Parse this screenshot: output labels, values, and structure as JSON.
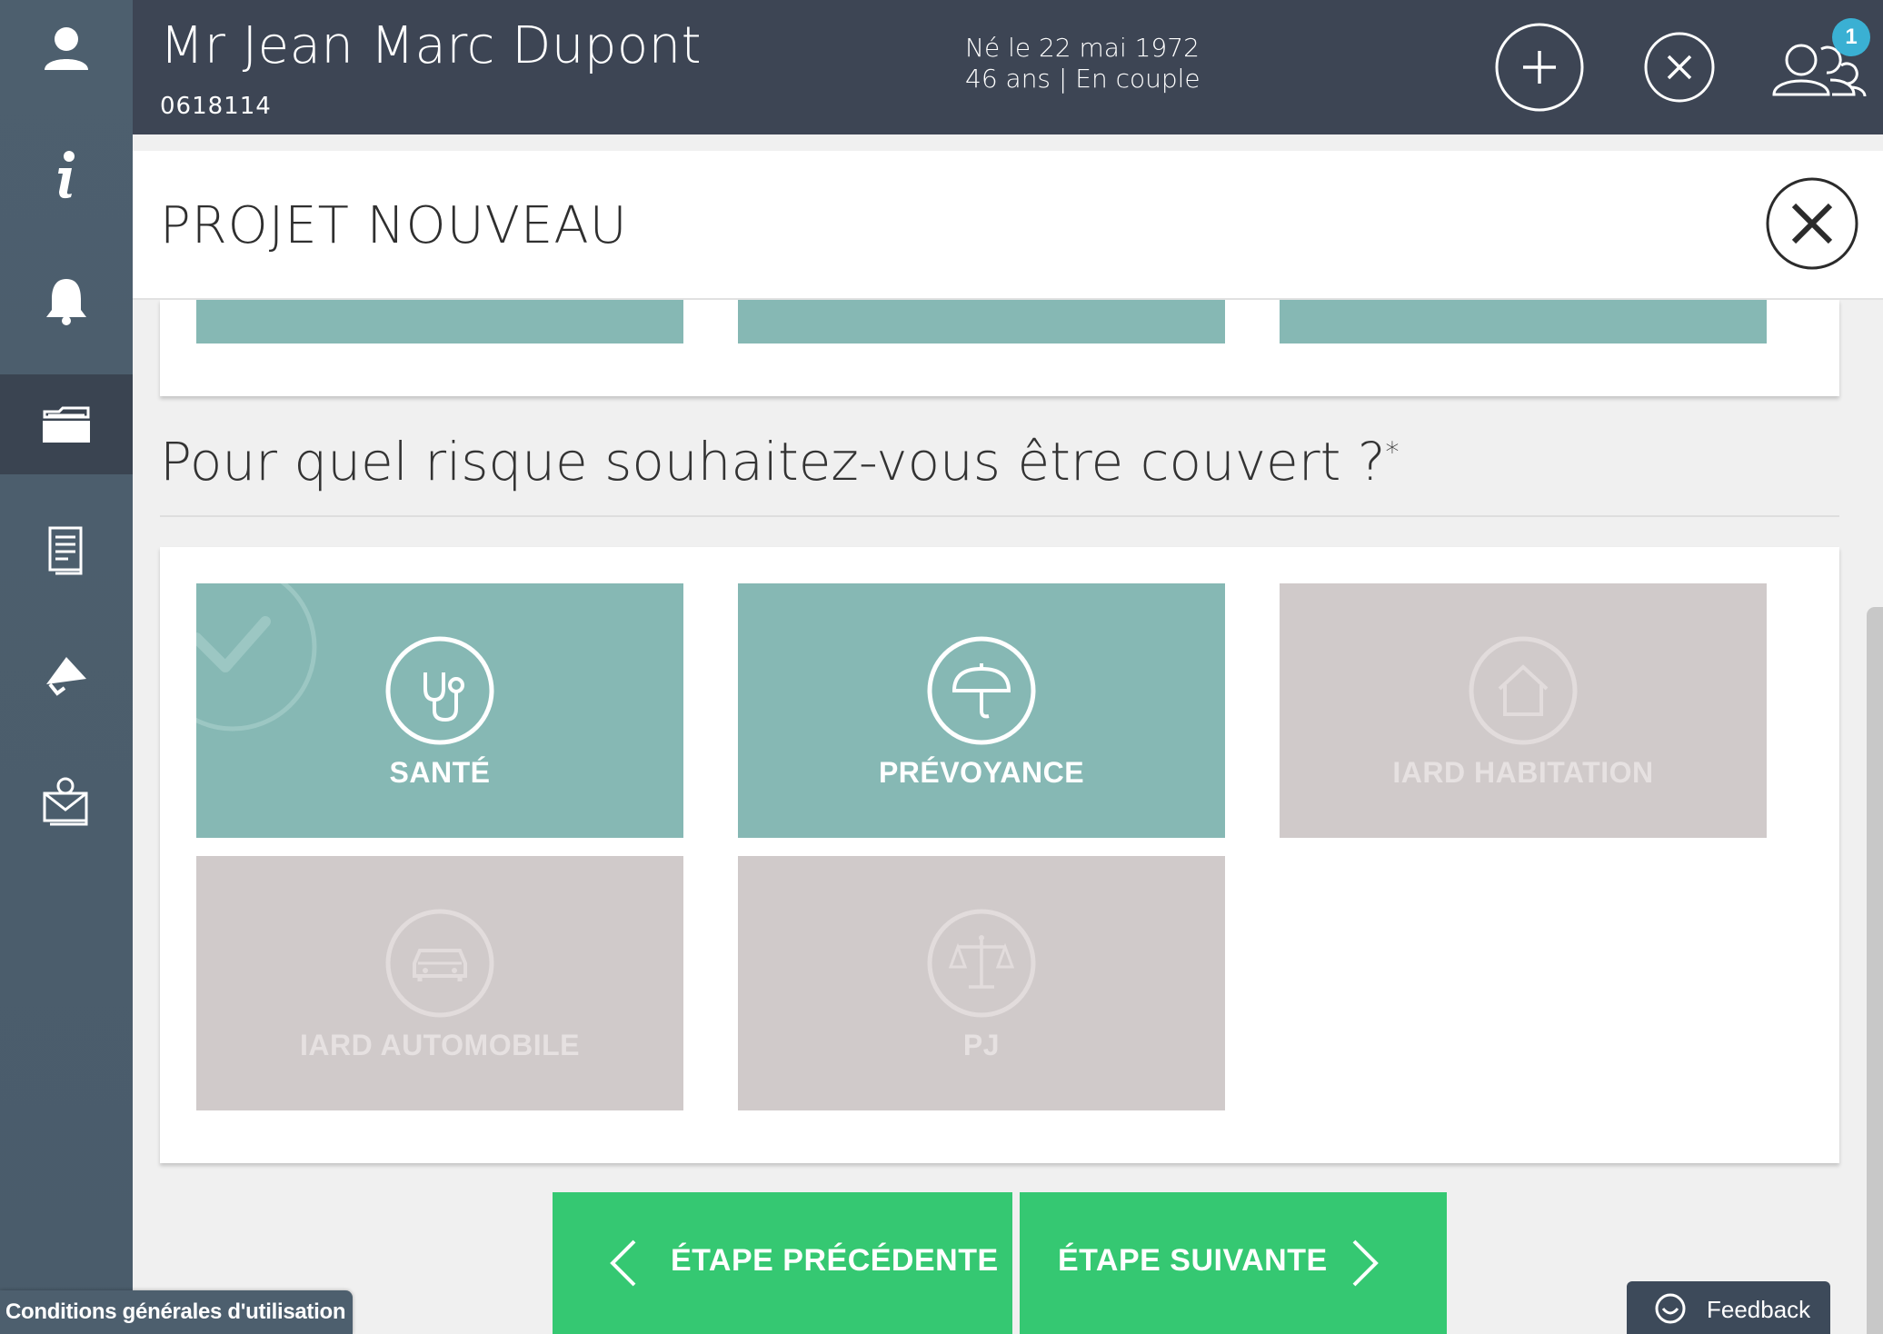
{
  "client": {
    "name": "Mr Jean Marc Dupont",
    "id": "0618114",
    "birth": "Né le 22 mai 1972",
    "age_status": "46 ans | En couple",
    "notification_count": "1"
  },
  "sidebar": {
    "items": [
      {
        "icon": "user-icon"
      },
      {
        "icon": "info-icon"
      },
      {
        "icon": "bell-icon"
      },
      {
        "icon": "folders-icon",
        "active": true
      },
      {
        "icon": "document-icon"
      },
      {
        "icon": "megaphone-icon"
      },
      {
        "icon": "mail-icon"
      }
    ]
  },
  "project": {
    "title": "PROJET NOUVEAU"
  },
  "question": {
    "text": "Pour quel risque souhaitez-vous être couvert ?",
    "required_mark": "*"
  },
  "options": [
    {
      "label": "SANTÉ",
      "icon": "stethoscope-icon",
      "state": "selected"
    },
    {
      "label": "PRÉVOYANCE",
      "icon": "umbrella-icon",
      "state": "selected"
    },
    {
      "label": "IARD HABITATION",
      "icon": "house-icon",
      "state": "disabled"
    },
    {
      "label": "IARD AUTOMOBILE",
      "icon": "car-icon",
      "state": "disabled"
    },
    {
      "label": "PJ",
      "icon": "scales-icon",
      "state": "disabled"
    }
  ],
  "navigation": {
    "prev_label": "ÉTAPE PRÉCÉDENTE",
    "next_label": "ÉTAPE SUIVANTE"
  },
  "footer": {
    "cgu_label": "Conditions générales d'utilisation",
    "feedback_label": "Feedback"
  },
  "colors": {
    "header_bg": "#3d4554",
    "sidebar_bg": "#4d5f6e",
    "selected_tile": "#86b8b4",
    "disabled_tile": "#d0caca",
    "nav_button": "#35c872",
    "badge": "#3ab0d3"
  }
}
